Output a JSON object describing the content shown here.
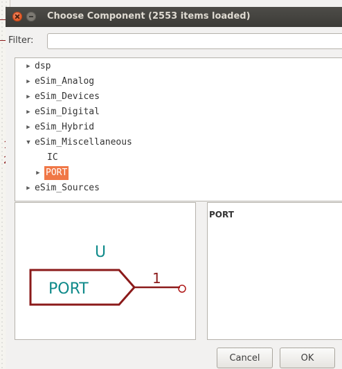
{
  "background": {
    "marks": [
      "1",
      "2"
    ]
  },
  "dialog": {
    "title": "Choose Component (2553 items loaded)",
    "filter": {
      "label": "Filter:",
      "value": "",
      "placeholder": ""
    },
    "tree": {
      "items": [
        {
          "label": "dsp",
          "expanded": false,
          "level": 0
        },
        {
          "label": "eSim_Analog",
          "expanded": false,
          "level": 0
        },
        {
          "label": "eSim_Devices",
          "expanded": false,
          "level": 0
        },
        {
          "label": "eSim_Digital",
          "expanded": false,
          "level": 0
        },
        {
          "label": "eSim_Hybrid",
          "expanded": false,
          "level": 0
        },
        {
          "label": "eSim_Miscellaneous",
          "expanded": true,
          "level": 0
        },
        {
          "label": "IC",
          "level": 1
        },
        {
          "label": "PORT",
          "expanded": false,
          "level": 1,
          "selected": true
        },
        {
          "label": "eSim_Sources",
          "expanded": false,
          "level": 0
        }
      ]
    },
    "preview": {
      "reference": "U",
      "value": "PORT",
      "pin_number": "1",
      "colors": {
        "body": "#8b1a1a",
        "text": "#0f8a8a",
        "pin_end": "#b01919"
      }
    },
    "description": {
      "title": "PORT"
    },
    "buttons": {
      "cancel": "Cancel",
      "ok": "OK"
    },
    "colors": {
      "titlebar": "#3c3b37",
      "selection": "#f07746"
    }
  }
}
